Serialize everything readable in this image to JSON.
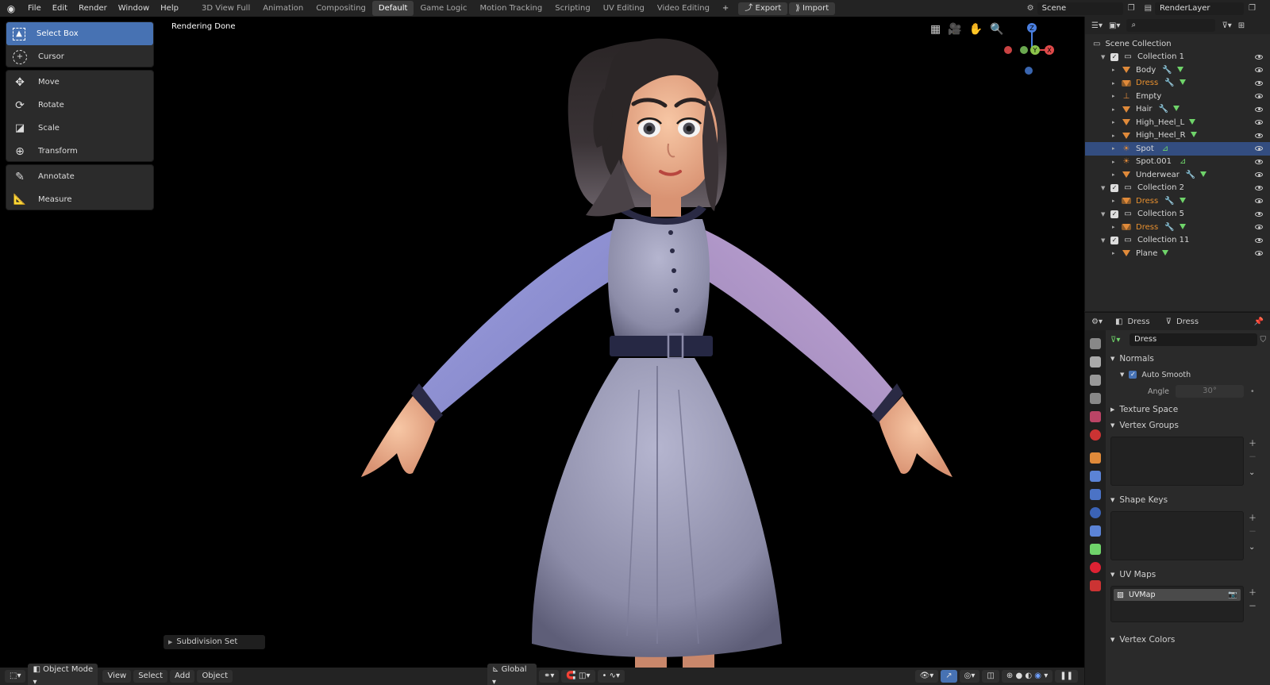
{
  "app": {
    "menus": [
      "File",
      "Edit",
      "Render",
      "Window",
      "Help"
    ],
    "workspaces": [
      "3D View Full",
      "Animation",
      "Compositing",
      "Default",
      "Game Logic",
      "Motion Tracking",
      "Scripting",
      "UV Editing",
      "Video Editing"
    ],
    "active_workspace": "Default",
    "add_workspace": "+",
    "export_label": "Export",
    "import_label": "Import",
    "scene": "Scene",
    "render_layer": "RenderLayer"
  },
  "viewport": {
    "status": "Rendering Done",
    "tools_group1": [
      "Select Box",
      "Cursor"
    ],
    "tools_group2": [
      "Move",
      "Rotate",
      "Scale",
      "Transform"
    ],
    "tools_group3": [
      "Annotate",
      "Measure"
    ],
    "active_tool": "Select Box",
    "last_operation": "Subdivision Set",
    "gizmo": {
      "z": "Z",
      "y": "Y",
      "x": "X"
    }
  },
  "bottom": {
    "mode": "Object Mode",
    "menus": [
      "View",
      "Select",
      "Add",
      "Object"
    ],
    "orientation": "Global"
  },
  "outliner": {
    "root": "Scene Collection",
    "rows": [
      {
        "name": "Collection 1",
        "kind": "collection",
        "indent": 1
      },
      {
        "name": "Body",
        "kind": "mesh",
        "indent": 2,
        "mod": true
      },
      {
        "name": "Dress",
        "kind": "mesh",
        "indent": 2,
        "mod": true,
        "highlight": true
      },
      {
        "name": "Empty",
        "kind": "empty",
        "indent": 2
      },
      {
        "name": "Hair",
        "kind": "mesh",
        "indent": 2,
        "mod": true
      },
      {
        "name": "High_Heel_L",
        "kind": "mesh",
        "indent": 2
      },
      {
        "name": "High_Heel_R",
        "kind": "mesh",
        "indent": 2
      },
      {
        "name": "Spot",
        "kind": "light",
        "indent": 2,
        "selected": true
      },
      {
        "name": "Spot.001",
        "kind": "light",
        "indent": 2
      },
      {
        "name": "Underwear",
        "kind": "mesh",
        "indent": 2,
        "mod": true
      },
      {
        "name": "Collection 2",
        "kind": "collection",
        "indent": 1
      },
      {
        "name": "Dress",
        "kind": "mesh",
        "indent": 2,
        "mod": true,
        "highlight": true
      },
      {
        "name": "Collection 5",
        "kind": "collection",
        "indent": 1
      },
      {
        "name": "Dress",
        "kind": "mesh",
        "indent": 2,
        "mod": true,
        "highlight": true
      },
      {
        "name": "Collection 11",
        "kind": "collection",
        "indent": 1
      },
      {
        "name": "Plane",
        "kind": "mesh",
        "indent": 2
      }
    ]
  },
  "properties": {
    "object_name": "Dress",
    "data_name": "Dress",
    "mesh_field": "Dress",
    "sections": {
      "normals": "Normals",
      "auto_smooth": "Auto Smooth",
      "angle_label": "Angle",
      "angle_value": "30°",
      "texture_space": "Texture Space",
      "vertex_groups": "Vertex Groups",
      "shape_keys": "Shape Keys",
      "uv_maps": "UV Maps",
      "uv_map_item": "UVMap",
      "vertex_colors": "Vertex Colors"
    }
  },
  "colors": {
    "accent": "#4772b3",
    "highlight_text": "#e8902f",
    "mesh_icon": "#e08a3a",
    "data_icon": "#6fd46a"
  }
}
